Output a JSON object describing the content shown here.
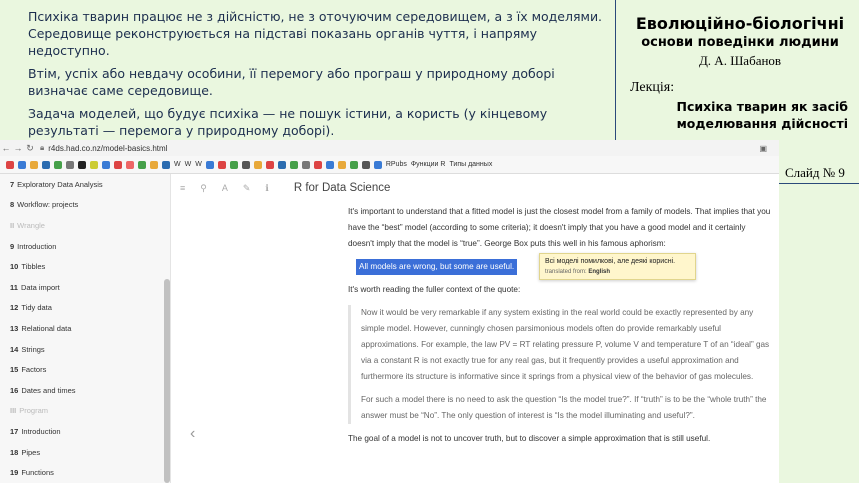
{
  "slide": {
    "paragraphs": [
      "Психіка тварин працює не з дійсністю, не з оточуючим середовищем, а з їх моделями. Середовище реконструюється на підставі показань органів чуття, і напряму недоступно.",
      "Втім, успіх або невдачу особини, її перемогу або програш у природному доборі визначає саме середовище.",
      "Задача моделей, що будує психіка — не пошук істини, а користь (у кінцевому результаті — перемога у природному доборі)."
    ],
    "course_title": "Еволюційно-біологічні",
    "course_subtitle": "основи поведінки людини",
    "author": "Д. А. Шабанов",
    "lecture_label": "Лекція:",
    "lecture_title": "Психіка тварин як засіб моделювання дійсності",
    "slide_number": "Слайд № 9"
  },
  "browser": {
    "url": "r4ds.had.co.nz/model-basics.html",
    "bookmarks": [
      "W",
      "W",
      "W",
      "RPubs",
      "Функции R",
      "Типы данных"
    ],
    "sidebar": [
      {
        "num": "7",
        "label": "Exploratory Data Analysis"
      },
      {
        "num": "8",
        "label": "Workflow: projects"
      },
      {
        "num": "II",
        "label": "Wrangle",
        "section": true
      },
      {
        "num": "9",
        "label": "Introduction"
      },
      {
        "num": "10",
        "label": "Tibbles"
      },
      {
        "num": "11",
        "label": "Data import"
      },
      {
        "num": "12",
        "label": "Tidy data"
      },
      {
        "num": "13",
        "label": "Relational data"
      },
      {
        "num": "14",
        "label": "Strings"
      },
      {
        "num": "15",
        "label": "Factors"
      },
      {
        "num": "16",
        "label": "Dates and times"
      },
      {
        "num": "III",
        "label": "Program",
        "section": true
      },
      {
        "num": "17",
        "label": "Introduction"
      },
      {
        "num": "18",
        "label": "Pipes"
      },
      {
        "num": "19",
        "label": "Functions"
      }
    ],
    "book_title": "R for Data Science",
    "para1": "It's important to understand that a fitted model is just the closest model from a family of models. That implies that you have the “best” model (according to some criteria); it doesn't imply that you have a good model and it certainly doesn't imply that the model is “true”. George Box puts this well in his famous aphorism:",
    "highlight": "All models are wrong, but some are useful.",
    "tooltip_translation": "Всі моделі помилкові, але деякі корисні.",
    "tooltip_from_label": "translated from:",
    "tooltip_from_lang": "English",
    "para2": "It's worth reading the fuller context of the quote:",
    "quote1": "Now it would be very remarkable if any system existing in the real world could be exactly represented by any simple model. However, cunningly chosen parsimonious models often do provide remarkably useful approximations. For example, the law PV = RT relating pressure P, volume V and temperature T of an “ideal” gas via a constant R is not exactly true for any real gas, but it frequently provides a useful approximation and furthermore its structure is informative since it springs from a physical view of the behavior of gas molecules.",
    "quote2": "For such a model there is no need to ask the question “Is the model true?”. If “truth” is to be the “whole truth” the answer must be “No”. The only question of interest is “Is the model illuminating and useful?”.",
    "para3": "The goal of a model is not to uncover truth, but to discover a simple approximation that is still useful."
  },
  "colors": {
    "slide_bg": "#eaf7df",
    "slide_text": "#1c2e4e",
    "highlight": "#3b6fd8",
    "tooltip_bg": "#fff6cc"
  }
}
